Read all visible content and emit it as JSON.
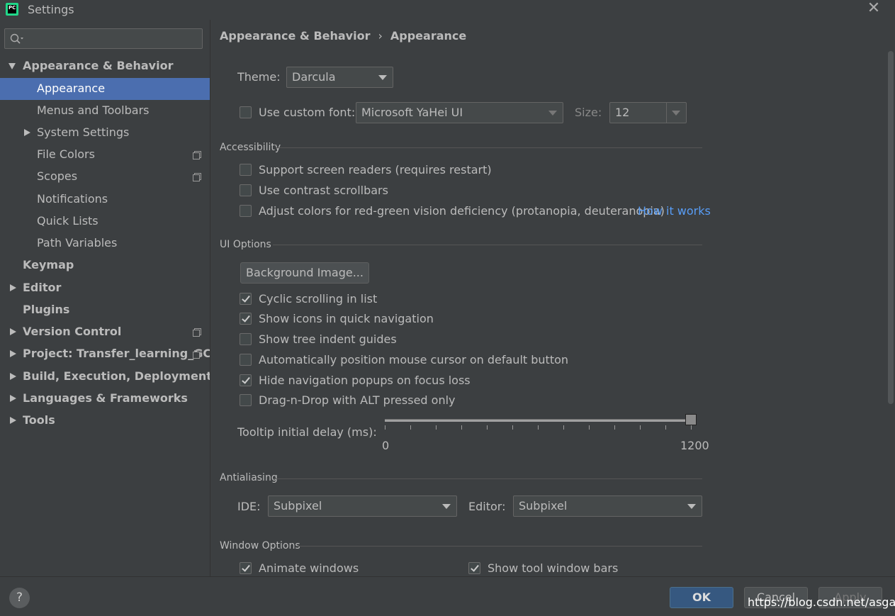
{
  "window": {
    "title": "Settings",
    "app_icon": "PC"
  },
  "sidebar": {
    "search_placeholder": "",
    "items": [
      {
        "label": "Appearance & Behavior"
      },
      {
        "label": "Appearance"
      },
      {
        "label": "Menus and Toolbars"
      },
      {
        "label": "System Settings"
      },
      {
        "label": "File Colors"
      },
      {
        "label": "Scopes"
      },
      {
        "label": "Notifications"
      },
      {
        "label": "Quick Lists"
      },
      {
        "label": "Path Variables"
      },
      {
        "label": "Keymap"
      },
      {
        "label": "Editor"
      },
      {
        "label": "Plugins"
      },
      {
        "label": "Version Control"
      },
      {
        "label": "Project: Transfer_learning_GCN"
      },
      {
        "label": "Build, Execution, Deployment"
      },
      {
        "label": "Languages & Frameworks"
      },
      {
        "label": "Tools"
      }
    ]
  },
  "breadcrumb": {
    "parent": "Appearance & Behavior",
    "separator": "›",
    "current": "Appearance"
  },
  "theme": {
    "label": "Theme:",
    "value": "Darcula"
  },
  "custom_font": {
    "label": "Use custom font:",
    "checked": false,
    "font_value": "Microsoft YaHei UI",
    "size_label": "Size:",
    "size_value": "12"
  },
  "accessibility": {
    "section": "Accessibility",
    "screen_readers": "Support screen readers (requires restart)",
    "contrast_scrollbars": "Use contrast scrollbars",
    "adjust_colors": "Adjust colors for red-green vision deficiency (protanopia, deuteranopia)",
    "how_it_works": "How it works"
  },
  "ui_options": {
    "section": "UI Options",
    "background_button": "Background Image...",
    "cyclic_scrolling": "Cyclic scrolling in list",
    "show_icons": "Show icons in quick navigation",
    "tree_indent": "Show tree indent guides",
    "auto_cursor": "Automatically position mouse cursor on default button",
    "hide_popups": "Hide navigation popups on focus loss",
    "drag_drop": "Drag-n-Drop with ALT pressed only",
    "tooltip_label": "Tooltip initial delay (ms):",
    "tooltip_min": "0",
    "tooltip_max": "1200",
    "tooltip_value": 1200
  },
  "antialiasing": {
    "section": "Antialiasing",
    "ide_label": "IDE:",
    "ide_value": "Subpixel",
    "editor_label": "Editor:",
    "editor_value": "Subpixel"
  },
  "window_options": {
    "section": "Window Options",
    "animate": "Animate windows",
    "tool_bars": "Show tool window bars"
  },
  "footer": {
    "help": "?",
    "ok": "OK",
    "cancel": "Cancel",
    "apply": "Apply",
    "watermark": "https://blog.csdn.net/asgags"
  },
  "colors": {
    "selection": "#4b6eaf",
    "link": "#589df6",
    "background": "#3c3f41",
    "ok_button": "#365880"
  }
}
